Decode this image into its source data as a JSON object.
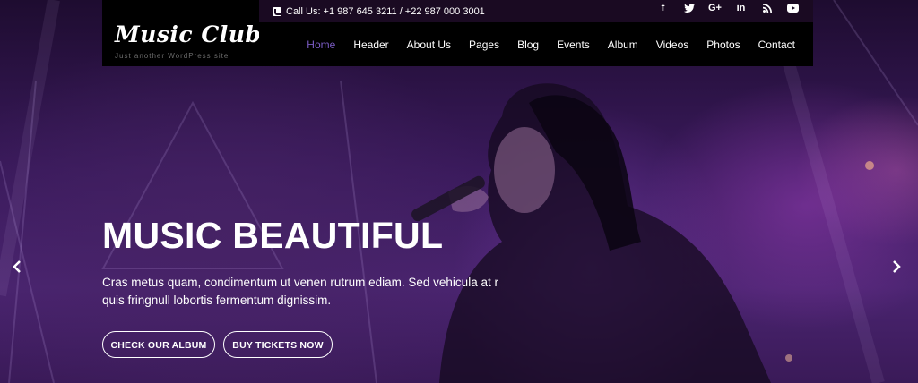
{
  "topbar": {
    "contact_label": "Call Us: +1 987 645 3211 / +22 987 000 3001",
    "social": [
      {
        "icon": "facebook-icon",
        "glyph": "f"
      },
      {
        "icon": "twitter-icon",
        "glyph": ""
      },
      {
        "icon": "google-plus-icon",
        "glyph": "G+"
      },
      {
        "icon": "linkedin-icon",
        "glyph": "in"
      },
      {
        "icon": "rss-icon",
        "glyph": ""
      },
      {
        "icon": "youtube-icon",
        "glyph": ""
      }
    ]
  },
  "logo": {
    "title": "Music Club",
    "tagline": "Just another WordPress site"
  },
  "nav": {
    "items": [
      {
        "label": "Home",
        "active": true
      },
      {
        "label": "Header"
      },
      {
        "label": "About Us"
      },
      {
        "label": "Pages"
      },
      {
        "label": "Blog"
      },
      {
        "label": "Events"
      },
      {
        "label": "Album"
      },
      {
        "label": "Videos"
      },
      {
        "label": "Photos"
      },
      {
        "label": "Contact"
      }
    ]
  },
  "hero": {
    "headline": "MUSIC BEAUTIFUL",
    "description": "Cras metus quam, condimentum ut venen rutrum ediam. Sed vehicula at r quis fringnull lobortis fermentum dignissim.",
    "primary_button": "CHECK OUR ALBUM",
    "secondary_button": "BUY TICKETS NOW"
  },
  "colors": {
    "accent": "#7b5cc4",
    "topbar_bg": "#1a0a22",
    "nav_bg": "#000000"
  }
}
